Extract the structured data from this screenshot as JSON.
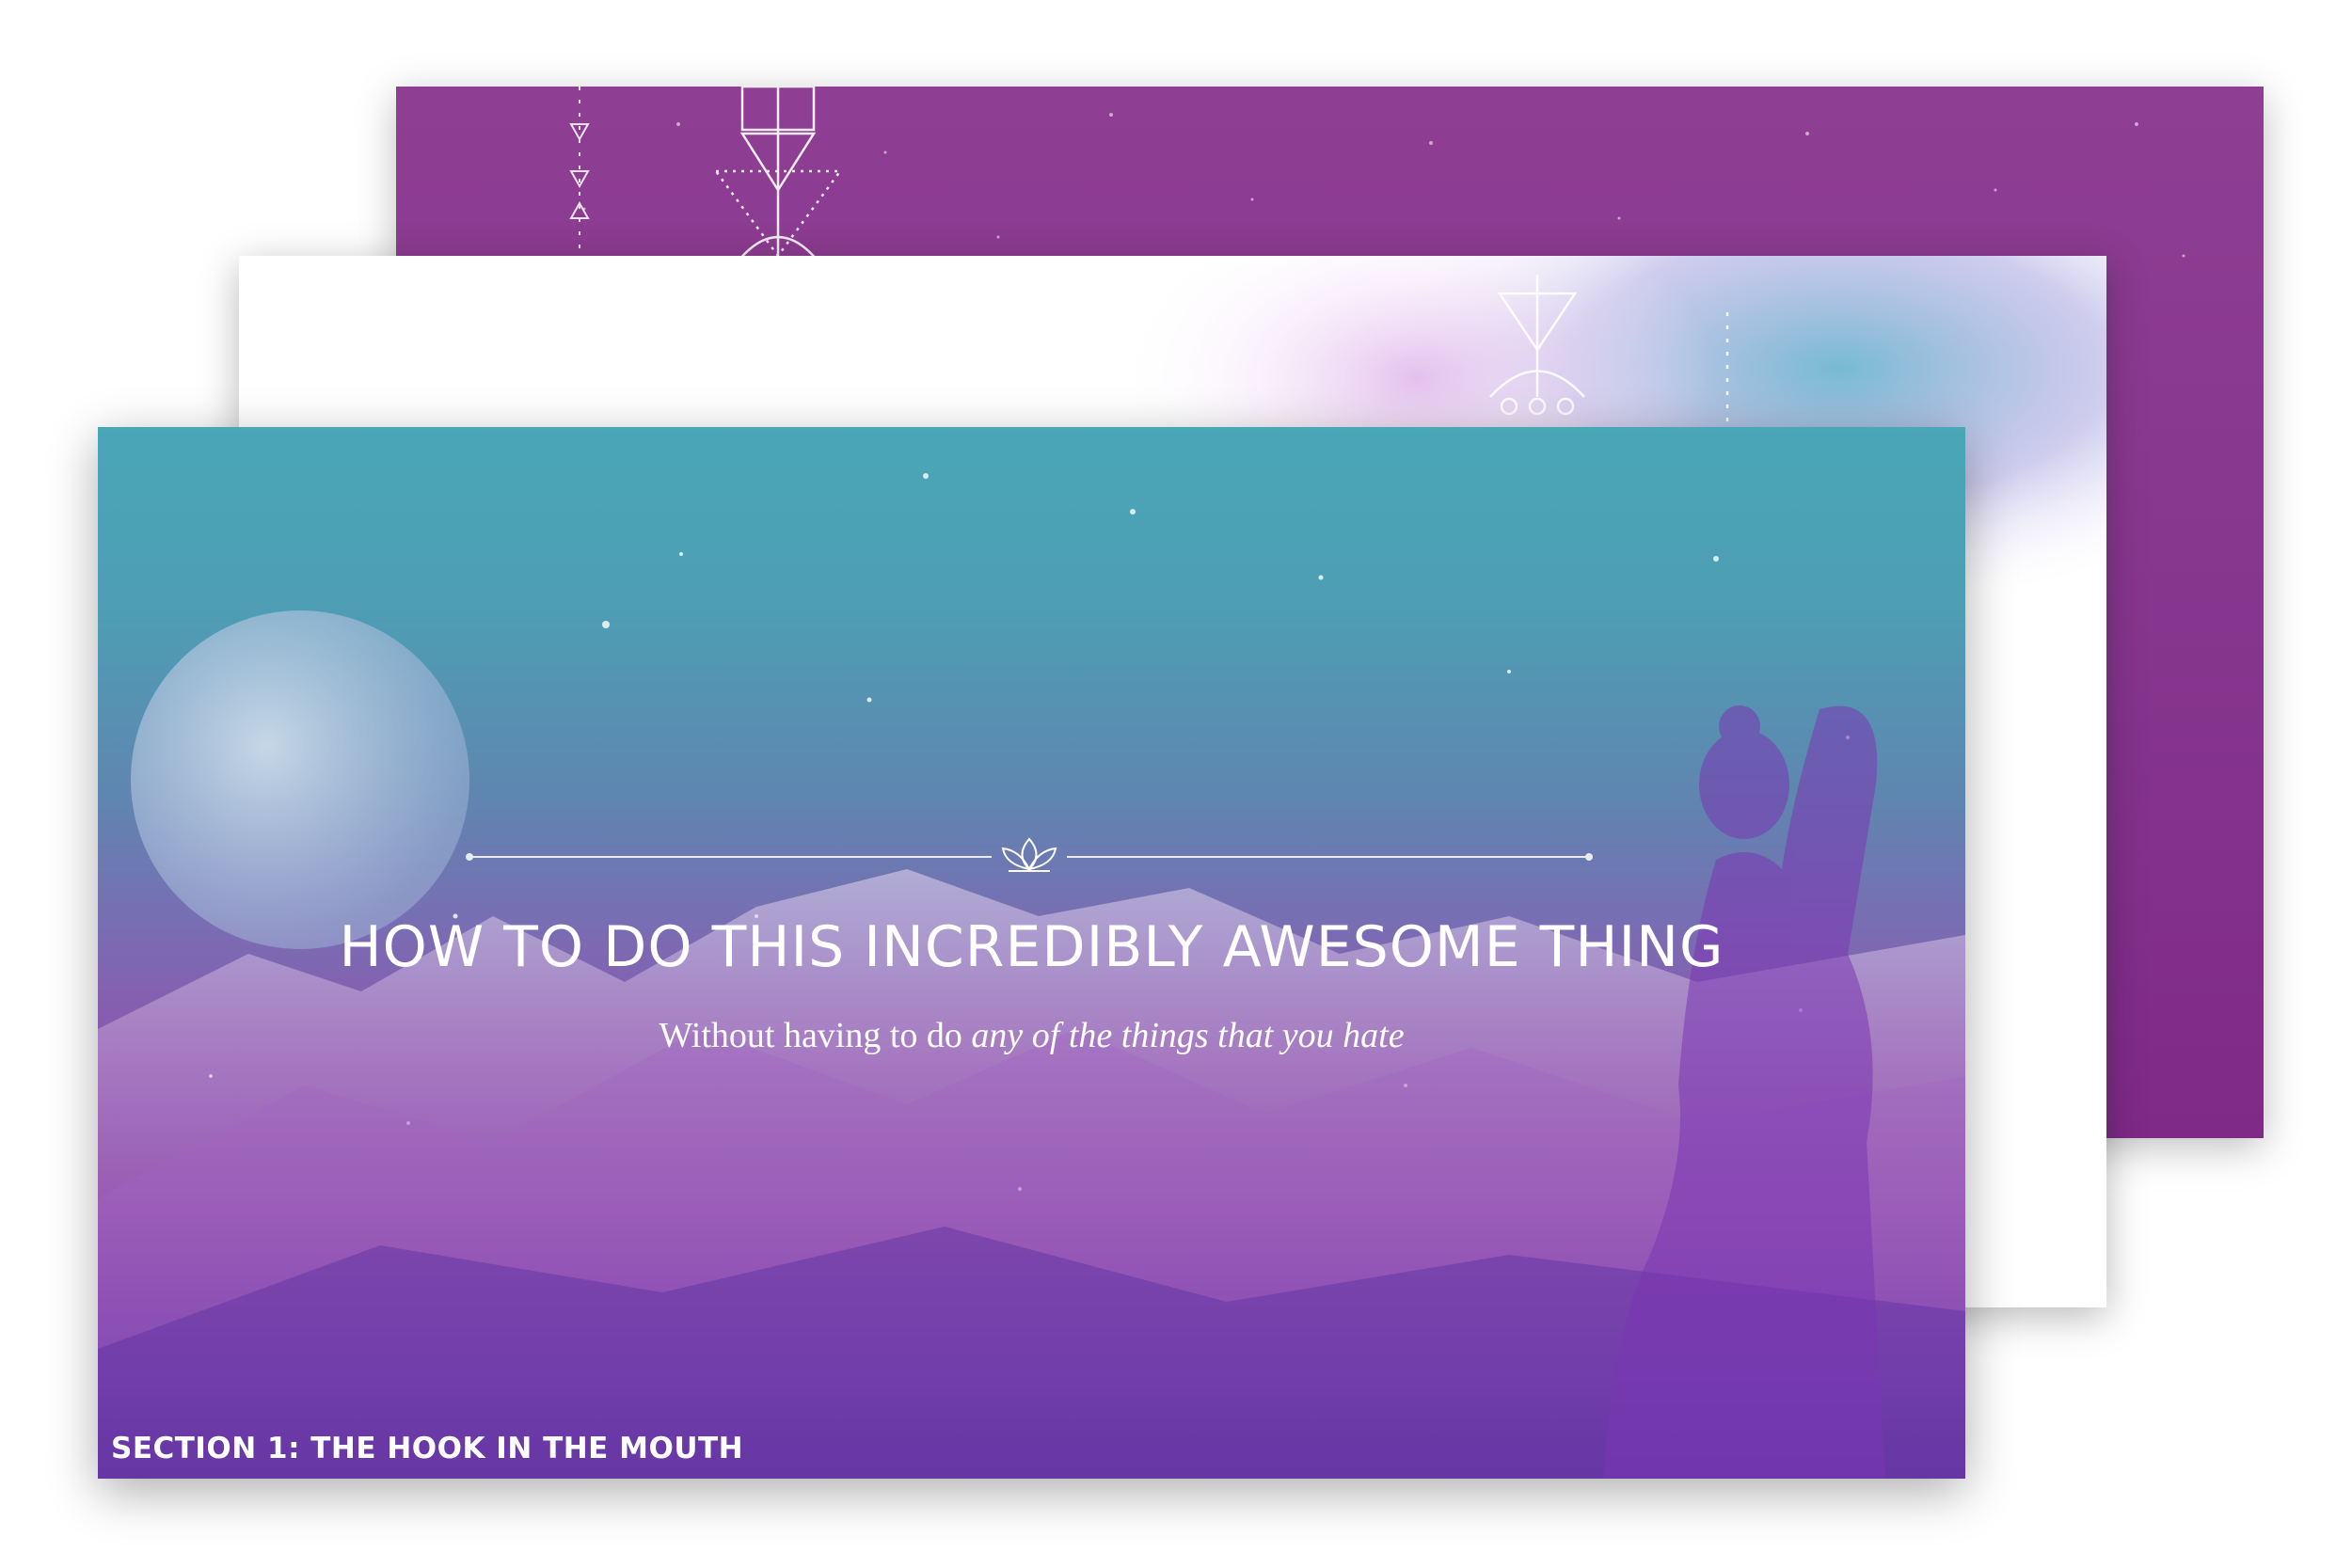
{
  "slides": [
    {
      "name": "back",
      "background": "#86358d"
    },
    {
      "name": "middle",
      "background": "#ffffff"
    },
    {
      "name": "front",
      "title": "HOW TO DO THIS INCREDIBLY AWESOME THING",
      "subtitle_plain": "Without having to do ",
      "subtitle_italic": "any of the things that you hate",
      "section_label": "SECTION 1: THE HOOK IN THE MOUTH",
      "colors": {
        "top": "#4aa7b6",
        "middle": "#8a45a8",
        "bottom": "#4b2596"
      }
    }
  ],
  "icons": [
    "moon-icon",
    "lotus-icon",
    "sacred-geometry-icon",
    "woman-silhouette"
  ]
}
